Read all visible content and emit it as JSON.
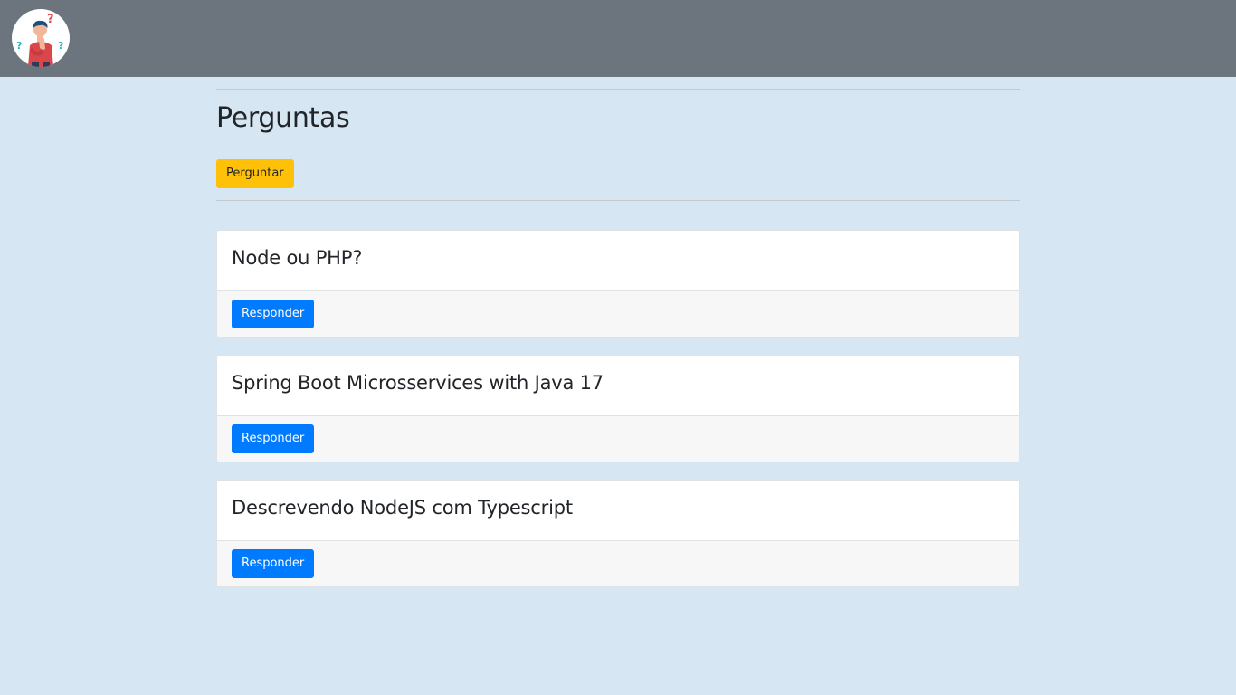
{
  "header": {
    "logo_icon": "person-thinking-question-icon"
  },
  "main": {
    "title": "Perguntas",
    "ask_button_label": "Perguntar",
    "questions": [
      {
        "title": "Node ou PHP?",
        "action_label": "Responder"
      },
      {
        "title": "Spring Boot Microsservices with Java 17",
        "action_label": "Responder"
      },
      {
        "title": "Descrevendo NodeJS com Typescript",
        "action_label": "Responder"
      }
    ]
  },
  "colors": {
    "navbar": "#6c757d",
    "background": "#d6e7f3",
    "ask_button": "#ffc107",
    "answer_button": "#007bff"
  }
}
